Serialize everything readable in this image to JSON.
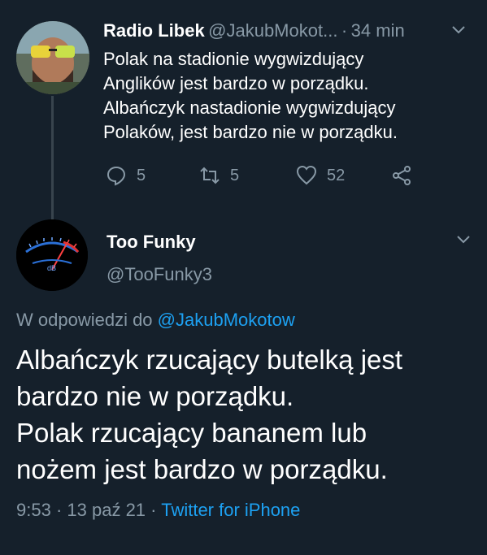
{
  "tweet1": {
    "display_name": "Radio Libek",
    "handle": "@JakubMokot...",
    "separator": "·",
    "time": "34 min",
    "lines": [
      "Polak na stadionie wygwizdujący",
      "Anglików jest bardzo w porządku.",
      "Albańczyk nastadionie wygwizdujący",
      "Polaków, jest bardzo nie w porządku."
    ],
    "replies": "5",
    "retweets": "5",
    "likes": "52"
  },
  "tweet2": {
    "display_name": "Too Funky",
    "handle": "@TooFunky3",
    "reply_prefix": "W odpowiedzi do",
    "reply_to": "@JakubMokotow",
    "lines": [
      "Albańczyk rzucający butelką jest",
      "bardzo nie w porządku.",
      "Polak rzucający bananem lub",
      "nożem jest bardzo w porządku."
    ],
    "time": "9:53",
    "sep1": "·",
    "date": "13 paź 21",
    "sep2": "·",
    "source": "Twitter for iPhone",
    "avatar_label": "dB"
  },
  "colors": {
    "background": "#15202b",
    "muted": "#8899a6",
    "link": "#1da1f2"
  }
}
